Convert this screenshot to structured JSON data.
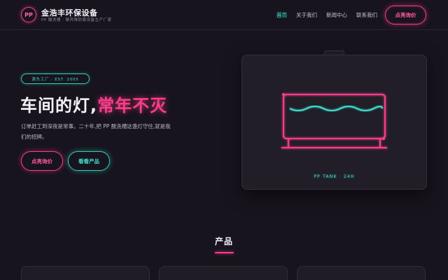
{
  "header": {
    "logo_text": "PP",
    "brand_name": "金浩丰环保设备",
    "tagline": "PP 酸洗槽 · 聚丙烯防腐设备生产厂家",
    "nav": [
      {
        "label": "首页",
        "active": true
      },
      {
        "label": "关于我们",
        "active": false
      },
      {
        "label": "新闻中心",
        "active": false
      },
      {
        "label": "联系我们",
        "active": false
      }
    ],
    "cta_label": "点亮询价"
  },
  "hero": {
    "badge": "源头工厂 · EST. 2005",
    "title_plain": "车间的灯,",
    "title_glow": "常年不灭",
    "description": "订单赶工到深夜是常事。二十年,把 PP 酸洗槽这盏灯守住,就是我们的招牌。",
    "primary_button": "点亮询价",
    "secondary_button": "看看产品"
  },
  "tank": {
    "caption": "PP TANK · 24H"
  },
  "products": {
    "title": "产品"
  },
  "colors": {
    "background": "#17141d",
    "neon_pink": "#ff3d8b",
    "neon_teal": "#3ee0cf",
    "card": "#221e28"
  }
}
